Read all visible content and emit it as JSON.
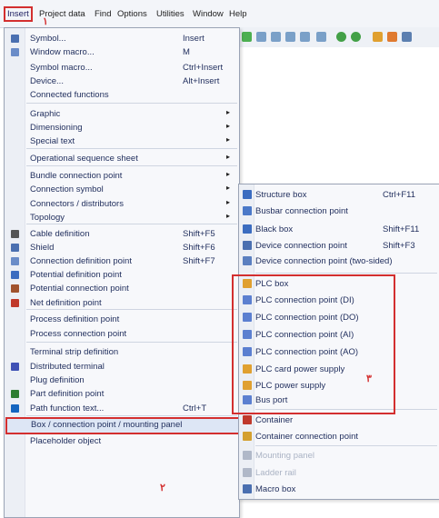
{
  "menubar": [
    {
      "label": "Insert",
      "active": true
    },
    {
      "label": "Project data"
    },
    {
      "label": "Find"
    },
    {
      "label": "Options"
    },
    {
      "label": "Utilities"
    },
    {
      "label": "Window"
    },
    {
      "label": "Help"
    }
  ],
  "insert_menu": [
    {
      "label": "Symbol...",
      "shortcut": "Insert",
      "icon": "symbol-icon"
    },
    {
      "label": "Window macro...",
      "shortcut": "M",
      "icon": "window-macro-icon"
    },
    {
      "label": "Symbol macro...",
      "shortcut": "Ctrl+Insert"
    },
    {
      "label": "Device...",
      "shortcut": "Alt+Insert"
    },
    {
      "label": "Connected functions"
    },
    {
      "label": "Graphic",
      "submenu": true
    },
    {
      "label": "Dimensioning",
      "submenu": true
    },
    {
      "label": "Special text",
      "submenu": true
    },
    {
      "label": "Operational sequence sheet",
      "submenu": true
    },
    {
      "label": "Bundle connection point",
      "submenu": true
    },
    {
      "label": "Connection symbol",
      "submenu": true
    },
    {
      "label": "Connectors / distributors",
      "submenu": true
    },
    {
      "label": "Topology",
      "submenu": true
    },
    {
      "label": "Cable definition",
      "shortcut": "Shift+F5",
      "icon": "cable-icon"
    },
    {
      "label": "Shield",
      "shortcut": "Shift+F6",
      "icon": "shield-icon"
    },
    {
      "label": "Connection definition point",
      "shortcut": "Shift+F7",
      "icon": "connection-def-icon"
    },
    {
      "label": "Potential definition point",
      "icon": "potential-def-icon"
    },
    {
      "label": "Potential connection point",
      "icon": "potential-conn-icon"
    },
    {
      "label": "Net definition point",
      "icon": "net-def-icon"
    },
    {
      "label": "Process definition point"
    },
    {
      "label": "Process connection point"
    },
    {
      "label": "Terminal strip definition"
    },
    {
      "label": "Distributed terminal",
      "icon": "distributed-terminal-icon"
    },
    {
      "label": "Plug definition"
    },
    {
      "label": "Part definition point",
      "icon": "part-def-icon"
    },
    {
      "label": "Path function text...",
      "shortcut": "Ctrl+T",
      "icon": "path-function-icon"
    },
    {
      "label": "Box / connection point / mounting panel",
      "highlighted": true
    },
    {
      "label": "Placeholder object"
    }
  ],
  "submenu": [
    {
      "label": "Structure box",
      "shortcut": "Ctrl+F11",
      "icon": "structure-box-icon"
    },
    {
      "label": "Busbar connection point",
      "icon": "busbar-icon"
    },
    {
      "label": "Black box",
      "shortcut": "Shift+F11",
      "icon": "black-box-icon"
    },
    {
      "label": "Device connection point",
      "shortcut": "Shift+F3",
      "icon": "device-conn-icon"
    },
    {
      "label": "Device connection point (two-sided)",
      "icon": "device-conn-2-icon"
    },
    {
      "label": "PLC box",
      "icon": "plc-box-icon"
    },
    {
      "label": "PLC connection point (DI)",
      "icon": "plc-di-icon"
    },
    {
      "label": "PLC connection point (DO)",
      "icon": "plc-do-icon"
    },
    {
      "label": "PLC connection point (AI)",
      "icon": "plc-ai-icon"
    },
    {
      "label": "PLC connection point (AO)",
      "icon": "plc-ao-icon"
    },
    {
      "label": "PLC card power supply",
      "icon": "plc-card-power-icon"
    },
    {
      "label": "PLC power supply",
      "icon": "plc-power-icon"
    },
    {
      "label": "Bus port",
      "icon": "bus-port-icon"
    },
    {
      "label": "Container",
      "icon": "container-icon"
    },
    {
      "label": "Container connection point",
      "icon": "container-conn-icon"
    },
    {
      "label": "Mounting panel",
      "disabled": true,
      "icon": "mounting-panel-icon"
    },
    {
      "label": "Ladder rail",
      "disabled": true,
      "icon": "ladder-rail-icon"
    },
    {
      "label": "Macro box",
      "icon": "macro-box-icon"
    }
  ],
  "annotations": {
    "mark1": "۱",
    "mark2": "۲",
    "mark3": "۳"
  },
  "colors": {
    "highlight": "#d32f2f",
    "menu_bg": "#f7f8fb",
    "text": "#1f2d5c"
  }
}
